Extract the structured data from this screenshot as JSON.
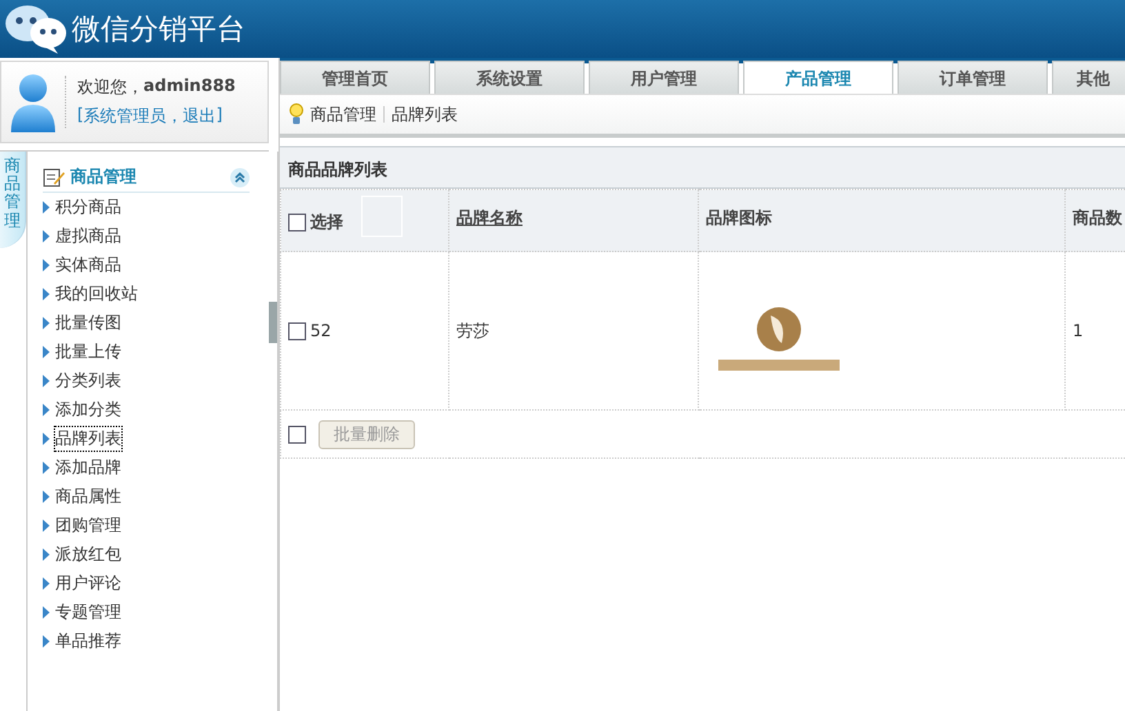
{
  "header": {
    "title": "微信分销平台"
  },
  "user": {
    "greeting": "欢迎您，",
    "name": "admin888",
    "open_bracket": "[",
    "role": "系统管理员",
    "separator": "，",
    "logout": "退出",
    "close_bracket": "]"
  },
  "sidebar": {
    "vertical_tab": "商品管理",
    "section_title": "商品管理",
    "expanded": true,
    "items": [
      {
        "label": "积分商品",
        "selected": false
      },
      {
        "label": "虚拟商品",
        "selected": false
      },
      {
        "label": "实体商品",
        "selected": false
      },
      {
        "label": "我的回收站",
        "selected": false
      },
      {
        "label": "批量传图",
        "selected": false
      },
      {
        "label": "批量上传",
        "selected": false
      },
      {
        "label": "分类列表",
        "selected": false
      },
      {
        "label": "添加分类",
        "selected": false
      },
      {
        "label": "品牌列表",
        "selected": true
      },
      {
        "label": "添加品牌",
        "selected": false
      },
      {
        "label": "商品属性",
        "selected": false
      },
      {
        "label": "团购管理",
        "selected": false
      },
      {
        "label": "派放红包",
        "selected": false
      },
      {
        "label": "用户评论",
        "selected": false
      },
      {
        "label": "专题管理",
        "selected": false
      },
      {
        "label": "单品推荐",
        "selected": false
      }
    ]
  },
  "tabs": [
    {
      "label": "管理首页",
      "selected": false
    },
    {
      "label": "系统设置",
      "selected": false
    },
    {
      "label": "用户管理",
      "selected": false
    },
    {
      "label": "产品管理",
      "selected": true
    },
    {
      "label": "订单管理",
      "selected": false
    },
    {
      "label": "其他",
      "selected": false
    }
  ],
  "breadcrumb": [
    "商品管理",
    "品牌列表"
  ],
  "panel": {
    "title": "商品品牌列表"
  },
  "table": {
    "columns": [
      {
        "label": "选择",
        "kind": "select",
        "checked": false
      },
      {
        "label": "品牌名称",
        "kind": "link"
      },
      {
        "label": "品牌图标",
        "kind": "plain"
      },
      {
        "label": "商品数",
        "kind": "plain"
      }
    ],
    "rows": [
      {
        "checked": false,
        "id": "52",
        "name": "劳莎",
        "count": "1"
      }
    ]
  },
  "footer": {
    "checked": false,
    "button": "批量删除",
    "button_disabled": true
  }
}
